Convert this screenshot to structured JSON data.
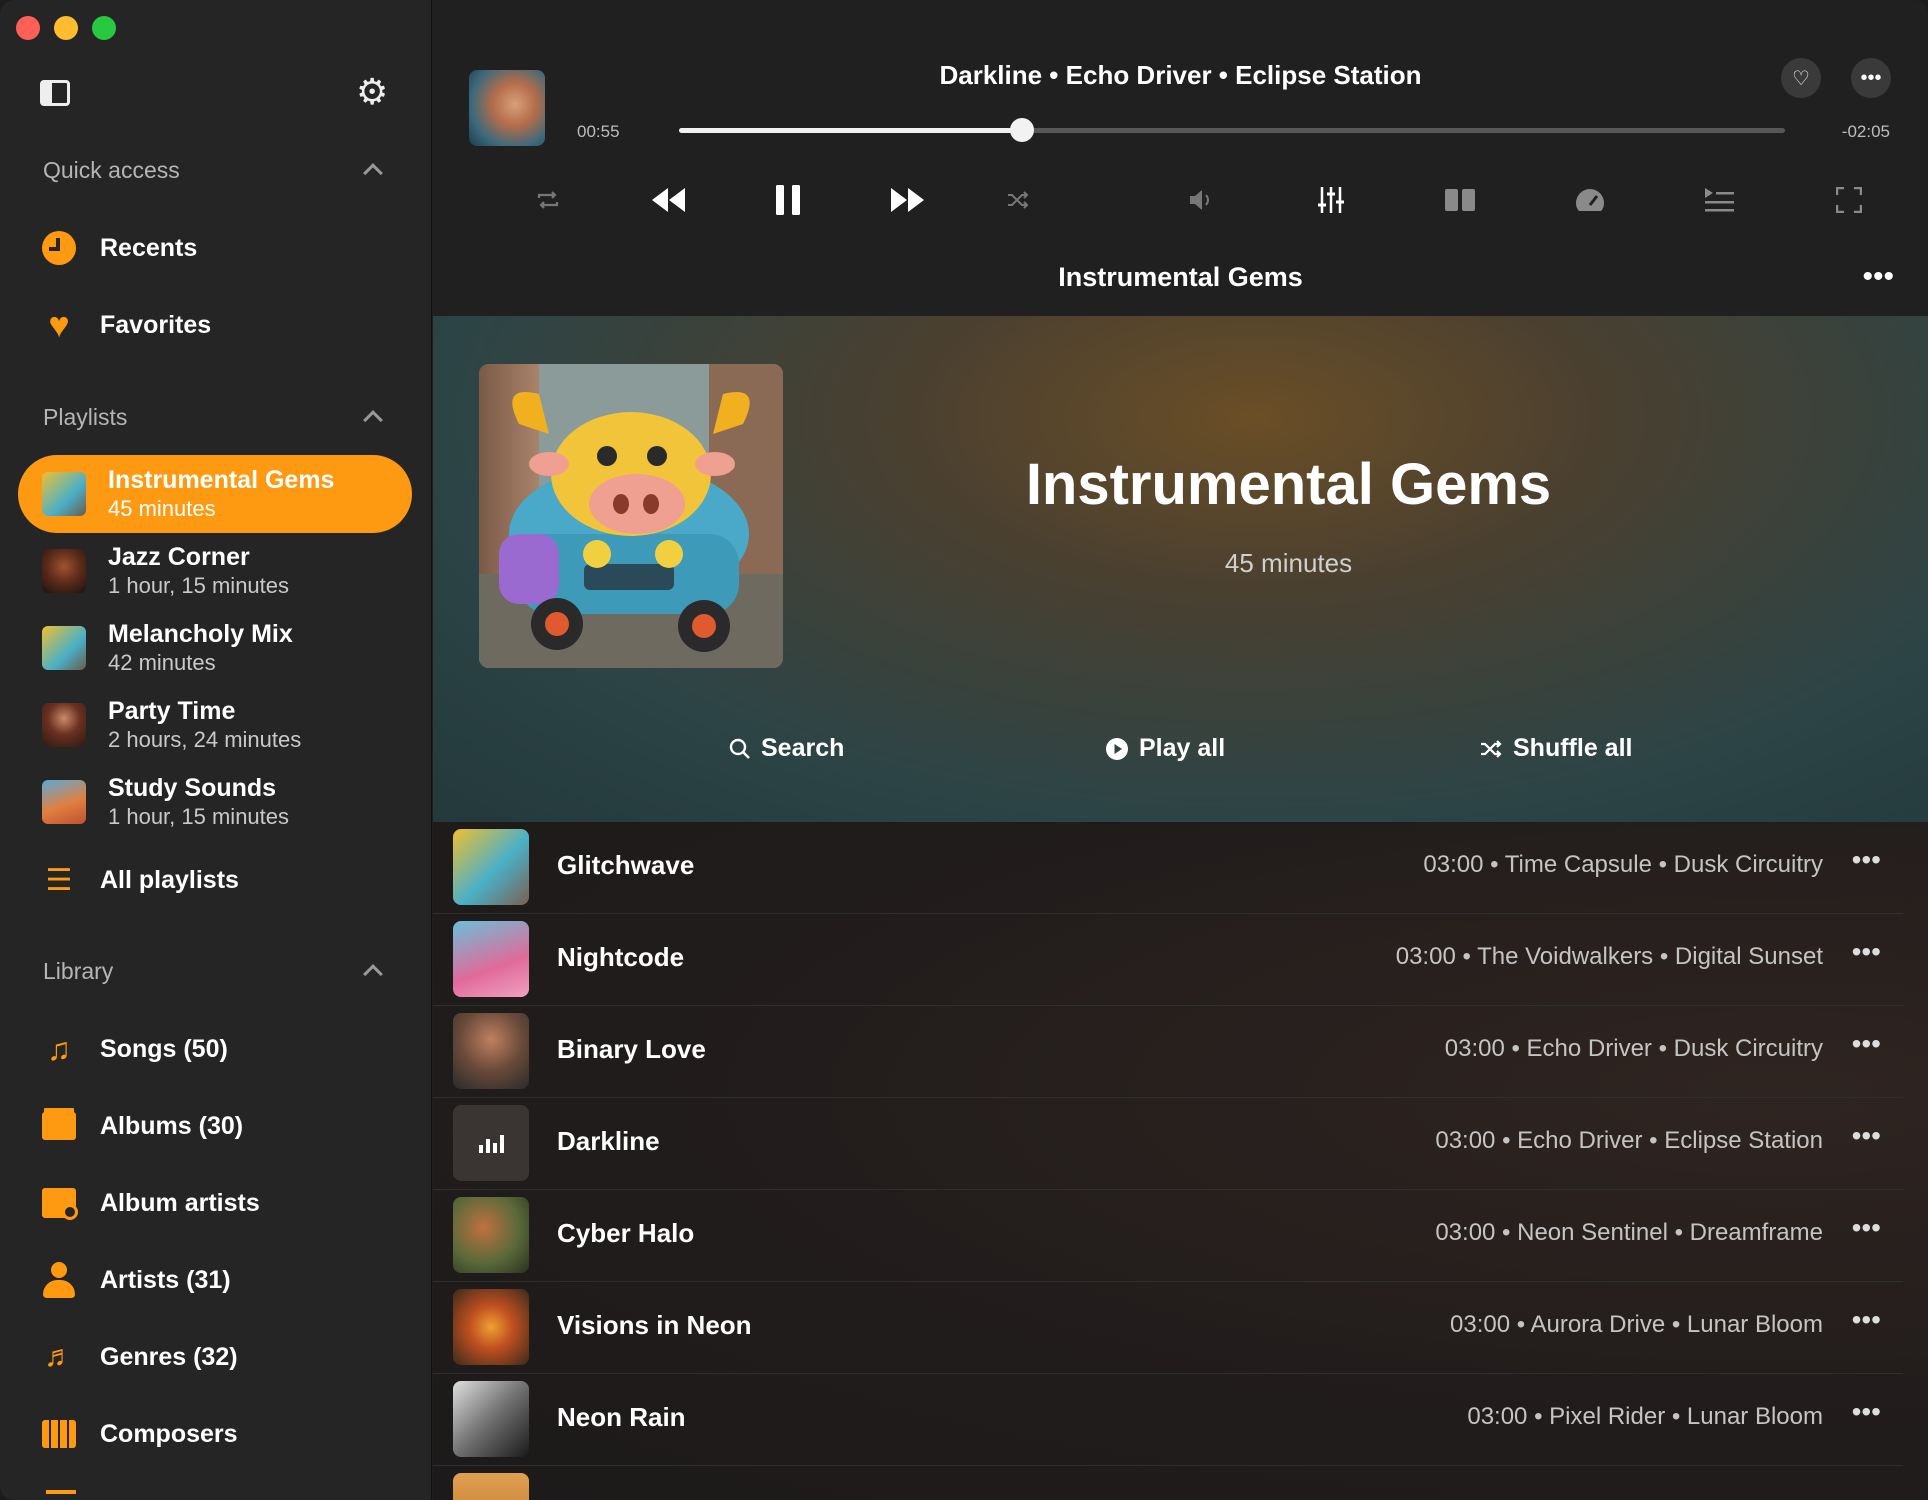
{
  "window": {
    "traffic_lights": [
      "close",
      "minimize",
      "zoom"
    ]
  },
  "sidebar": {
    "quick_access": {
      "header": "Quick access",
      "items": [
        {
          "label": "Recents",
          "icon": "clock-icon"
        },
        {
          "label": "Favorites",
          "icon": "heart-icon"
        }
      ]
    },
    "playlists": {
      "header": "Playlists",
      "items": [
        {
          "name": "Instrumental Gems",
          "duration": "45 minutes",
          "active": true
        },
        {
          "name": "Jazz Corner",
          "duration": "1 hour, 15 minutes"
        },
        {
          "name": "Melancholy Mix",
          "duration": "42 minutes"
        },
        {
          "name": "Party Time",
          "duration": "2 hours, 24 minutes"
        },
        {
          "name": "Study Sounds",
          "duration": "1 hour, 15 minutes"
        }
      ],
      "all_label": "All playlists"
    },
    "library": {
      "header": "Library",
      "items": [
        {
          "label": "Songs (50)",
          "icon": "music-note-icon"
        },
        {
          "label": "Albums (30)",
          "icon": "albums-icon"
        },
        {
          "label": "Album artists",
          "icon": "album-artists-icon"
        },
        {
          "label": "Artists (31)",
          "icon": "person-icon"
        },
        {
          "label": "Genres (32)",
          "icon": "genres-icon"
        },
        {
          "label": "Composers",
          "icon": "piano-icon"
        }
      ]
    },
    "accent_color": "#fe9a12"
  },
  "now_playing": {
    "title_line": "Darkline • Echo Driver • Eclipse Station",
    "elapsed": "00:55",
    "remaining": "-02:05",
    "progress_fraction": 0.31
  },
  "playlist": {
    "header_title": "Instrumental Gems",
    "title": "Instrumental Gems",
    "duration": "45 minutes",
    "actions": {
      "search": "Search",
      "play_all": "Play all",
      "shuffle_all": "Shuffle all"
    },
    "songs": [
      {
        "title": "Glitchwave",
        "meta": "03:00 • Time Capsule • Dusk Circuitry"
      },
      {
        "title": "Nightcode",
        "meta": "03:00 • The Voidwalkers • Digital Sunset"
      },
      {
        "title": "Binary Love",
        "meta": "03:00 • Echo Driver • Dusk Circuitry"
      },
      {
        "title": "Darkline",
        "meta": "03:00 • Echo Driver • Eclipse Station"
      },
      {
        "title": "Cyber Halo",
        "meta": "03:00 • Neon Sentinel • Dreamframe"
      },
      {
        "title": "Visions in Neon",
        "meta": "03:00 • Aurora Drive • Lunar Bloom"
      },
      {
        "title": "Neon Rain",
        "meta": "03:00 • Pixel Rider • Lunar Bloom"
      }
    ]
  }
}
